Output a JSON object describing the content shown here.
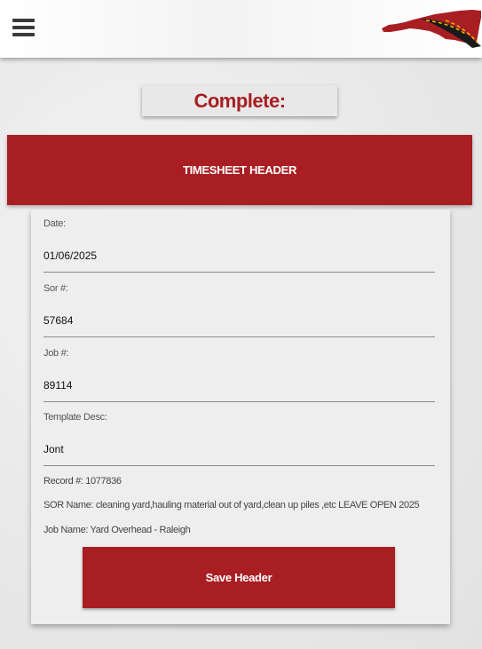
{
  "header": {
    "menu_icon": "hamburger-menu-icon",
    "logo_icon": "north-carolina-road-logo"
  },
  "status": {
    "label": "Complete:"
  },
  "section": {
    "title": "TIMESHEET HEADER"
  },
  "form": {
    "date": {
      "label": "Date:",
      "value": "01/06/2025"
    },
    "sor": {
      "label": "Sor #:",
      "value": "57684"
    },
    "job": {
      "label": "Job #:",
      "value": "89114"
    },
    "template": {
      "label": "Template Desc:",
      "value": "Jont"
    }
  },
  "info": {
    "record": "Record #: 1077836",
    "sor_name": "SOR Name: cleaning yard,hauling material out of yard,clean up piles ,etc LEAVE OPEN 2025",
    "job_name": "Job Name: Yard Overhead - Raleigh"
  },
  "actions": {
    "save_label": "Save Header"
  },
  "colors": {
    "accent": "#a81e23",
    "logo_road": "#1a1a1a",
    "logo_stripe": "#f2c200"
  }
}
